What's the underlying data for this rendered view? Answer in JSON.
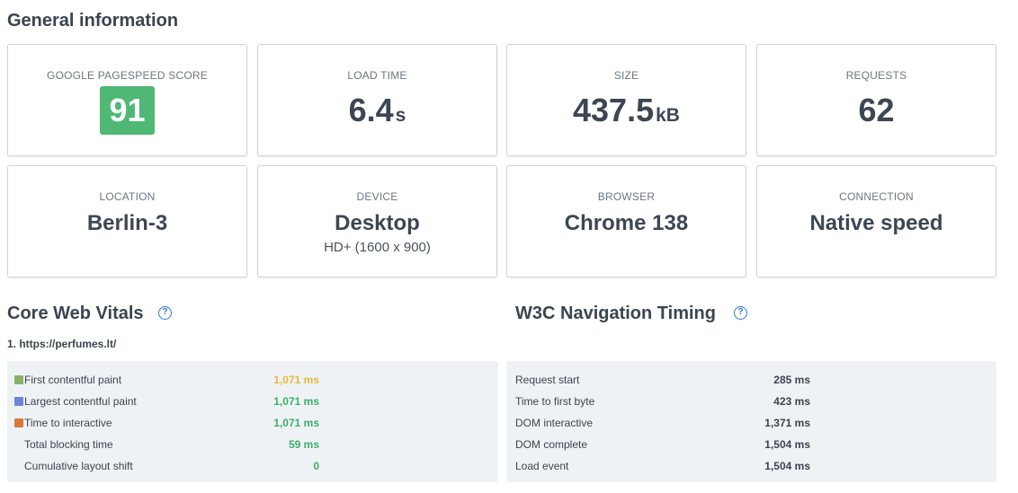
{
  "general": {
    "title": "General information",
    "cards": {
      "pagespeed": {
        "label": "GOOGLE PAGESPEED SCORE",
        "value": "91",
        "color": "#4fb875"
      },
      "load_time": {
        "label": "LOAD TIME",
        "value": "6.4",
        "unit": "s"
      },
      "size": {
        "label": "SIZE",
        "value": "437.5",
        "unit": "kB"
      },
      "requests": {
        "label": "REQUESTS",
        "value": "62"
      },
      "location": {
        "label": "LOCATION",
        "value": "Berlin-3"
      },
      "device": {
        "label": "DEVICE",
        "value": "Desktop",
        "sub": "HD+ (1600 x 900)"
      },
      "browser": {
        "label": "BROWSER",
        "value": "Chrome 138"
      },
      "connection": {
        "label": "CONNECTION",
        "value": "Native speed"
      }
    }
  },
  "core_web_vitals": {
    "title": "Core Web Vitals",
    "help_icon": "question-circle-icon",
    "url": "1. https://perfumes.lt/",
    "rows": [
      {
        "label": "First contentful paint",
        "value": "1,071 ms",
        "swatch": "#86b26a",
        "value_color": "#e9b93a"
      },
      {
        "label": "Largest contentful paint",
        "value": "1,071 ms",
        "swatch": "#6f84d9",
        "value_color": "#3dae6a"
      },
      {
        "label": "Time to interactive",
        "value": "1,071 ms",
        "swatch": "#d9773f",
        "value_color": "#3dae6a"
      },
      {
        "label": "Total blocking time",
        "value": "59 ms",
        "value_color": "#3dae6a"
      },
      {
        "label": "Cumulative layout shift",
        "value": "0",
        "value_color": "#3dae6a"
      }
    ]
  },
  "w3c": {
    "title": "W3C Navigation Timing",
    "help_icon": "question-circle-icon",
    "rows": [
      {
        "label": "Request start",
        "value": "285 ms"
      },
      {
        "label": "Time to first byte",
        "value": "423 ms"
      },
      {
        "label": "DOM interactive",
        "value": "1,371 ms"
      },
      {
        "label": "DOM complete",
        "value": "1,504 ms"
      },
      {
        "label": "Load event",
        "value": "1,504 ms"
      }
    ]
  }
}
